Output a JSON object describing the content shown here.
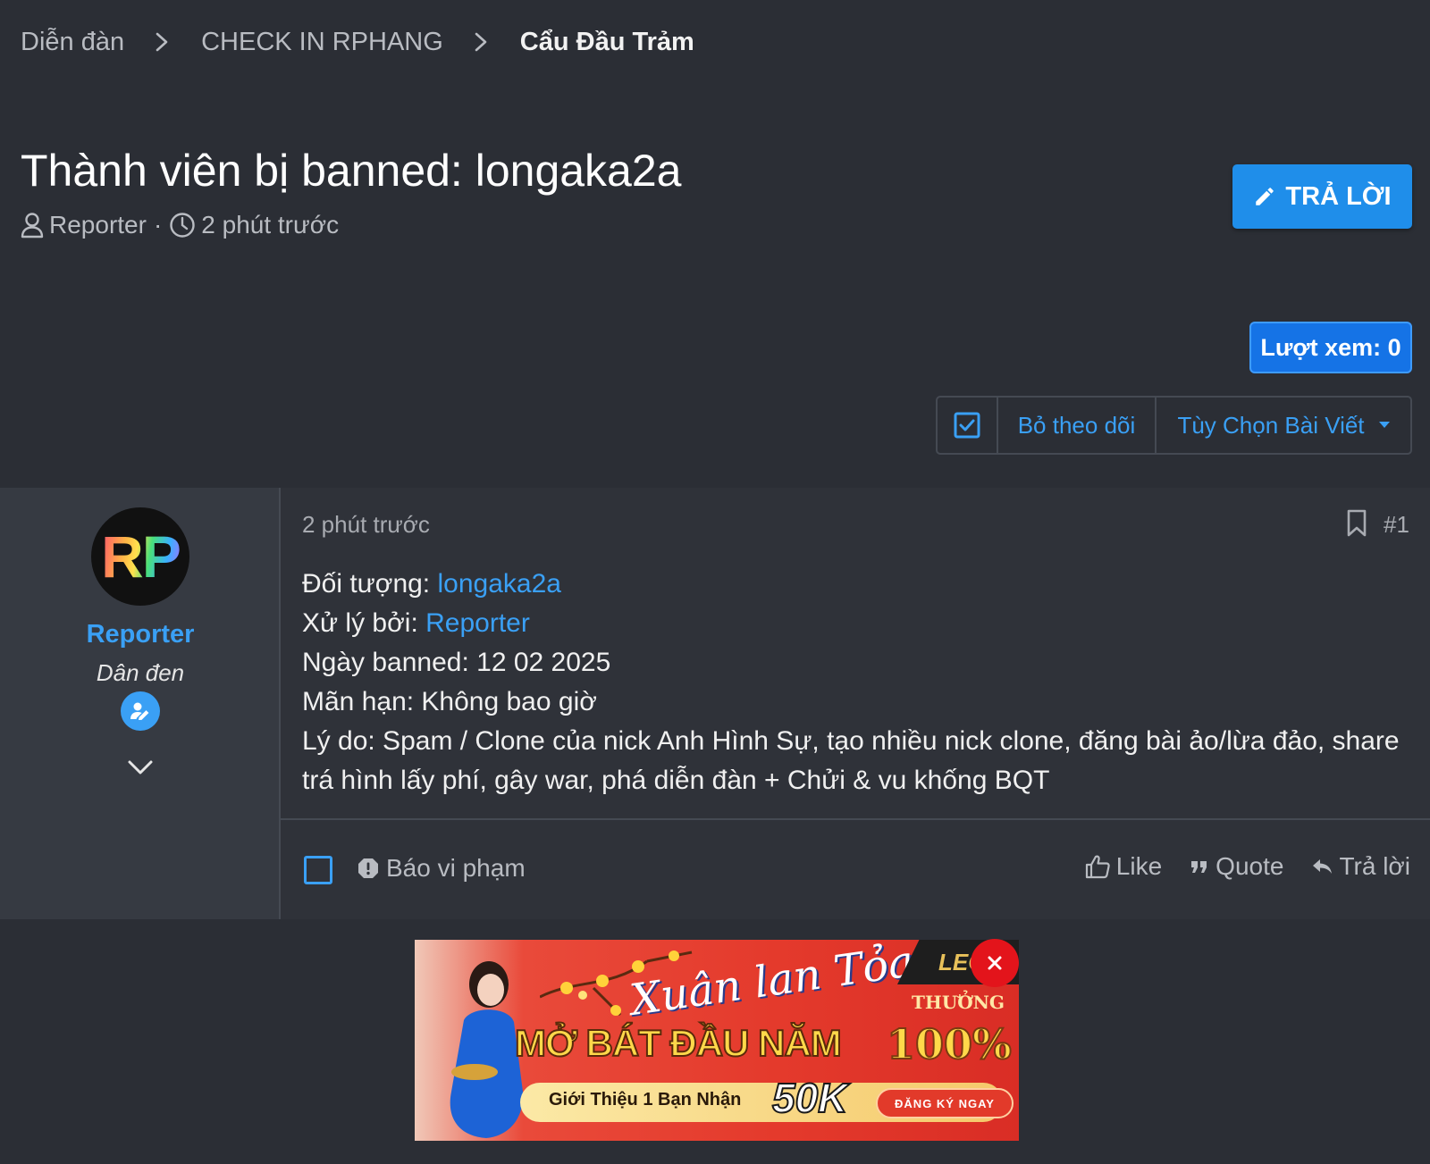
{
  "breadcrumb": {
    "items": [
      "Diễn đàn",
      "CHECK IN RPHANG"
    ],
    "current": "Cẩu Đầu Trảm"
  },
  "thread": {
    "title": "Thành viên bị banned: longaka2a",
    "author": "Reporter",
    "separator": "·",
    "time": "2 phút trước"
  },
  "reply_button": {
    "label": "TRẢ LỜI"
  },
  "views": {
    "label": "Lượt xem: 0"
  },
  "tools": {
    "unfollow": "Bỏ theo dõi",
    "options": "Tùy Chọn Bài Viết"
  },
  "post": {
    "user": {
      "avatar_text": "RP",
      "name": "Reporter",
      "title": "Dân đen"
    },
    "date": "2 phút trước",
    "number": "#1",
    "fields": {
      "target_label": "Đối tượng: ",
      "target_value": "longaka2a",
      "handler_label": "Xử lý bởi: ",
      "handler_value": "Reporter",
      "ban_date": "Ngày banned: 12 02 2025",
      "expiry": "Mãn hạn: Không bao giờ",
      "reason": "Lý do: Spam / Clone của nick Anh Hình Sự, tạo nhiều nick clone, đăng bài ảo/lừa đảo, share trá hình lấy phí, gây war, phá diễn đàn + Chửi & vu khống BQT"
    },
    "footer": {
      "report": "Báo vi phạm",
      "like": "Like",
      "quote": "Quote",
      "reply": "Trả lời"
    }
  },
  "ad": {
    "script_text": "Xuân lan Tỏa",
    "logo": "LEO",
    "thuong": "THƯỞNG",
    "headline": "MỞ BÁT ĐẦU NĂM",
    "percent": "100%",
    "intro": "Giới Thiệu 1 Bạn Nhận",
    "amount": "50K",
    "cta": "ĐĂNG KÝ NGAY"
  },
  "colors": {
    "background": "#2b2e35",
    "accent": "#3aa0f5",
    "button": "#1f8eea",
    "close": "#e3141b"
  }
}
